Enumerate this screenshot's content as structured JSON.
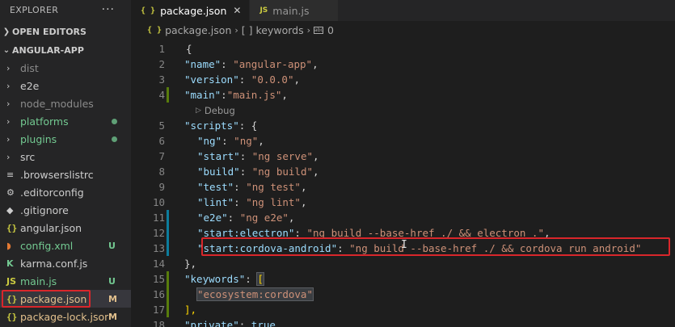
{
  "explorer": {
    "title": "EXPLORER",
    "more": "···",
    "open_editors": "OPEN EDITORS",
    "project": "ANGULAR-APP",
    "files": [
      {
        "label": "dist",
        "badge": ""
      },
      {
        "label": "e2e",
        "badge": ""
      },
      {
        "label": "node_modules",
        "badge": ""
      },
      {
        "label": "platforms",
        "badge": ""
      },
      {
        "label": "plugins",
        "badge": ""
      },
      {
        "label": "src",
        "badge": ""
      },
      {
        "label": ".browserslistrc",
        "badge": ""
      },
      {
        "label": ".editorconfig",
        "badge": ""
      },
      {
        "label": ".gitignore",
        "badge": ""
      },
      {
        "label": "angular.json",
        "badge": ""
      },
      {
        "label": "config.xml",
        "badge": "U"
      },
      {
        "label": "karma.conf.js",
        "badge": ""
      },
      {
        "label": "main.js",
        "badge": "U"
      },
      {
        "label": "package.json",
        "badge": "M"
      },
      {
        "label": "package-lock.json",
        "badge": "M"
      }
    ]
  },
  "tabs": [
    {
      "label": "package.json",
      "icon": "{ }",
      "close": "✕"
    },
    {
      "label": "main.js",
      "icon": "JS"
    }
  ],
  "breadcrumb": {
    "file": "package.json",
    "icon_file": "{ }",
    "icon_keywords": "[ ]",
    "keywords": "keywords",
    "index": "0",
    "sep": "›"
  },
  "codelens": "Debug",
  "code": {
    "l1": "{",
    "name_key": "\"name\"",
    "name_val": "\"angular-app\"",
    "version_key": "\"version\"",
    "version_val": "\"0.0.0\"",
    "main_key": "\"main\"",
    "main_val": "\"main.js\"",
    "scripts_key": "\"scripts\"",
    "ng_key": "\"ng\"",
    "ng_val": "\"ng\"",
    "start_key": "\"start\"",
    "start_val": "\"ng serve\"",
    "build_key": "\"build\"",
    "build_val": "\"ng build\"",
    "test_key": "\"test\"",
    "test_val": "\"ng test\"",
    "lint_key": "\"lint\"",
    "lint_val": "\"ng lint\"",
    "e2e_key": "\"e2e\"",
    "e2e_val": "\"ng e2e\"",
    "electron_key": "\"start:electron\"",
    "electron_val": "\"ng build --base-href ./ && electron .\"",
    "cordova_key": "\"start:cordova-android\"",
    "cordova_val": "\"ng build --base-href ./ && cordova run android\"",
    "close_obj": "},",
    "keywords_key": "\"keywords\"",
    "keyword_val": "\"ecosystem:cordova\"",
    "close_arr": "],",
    "private_key": "\"private\"",
    "private_val": "true"
  },
  "line_numbers": [
    "1",
    "2",
    "3",
    "4",
    "5",
    "6",
    "7",
    "8",
    "9",
    "10",
    "11",
    "12",
    "13",
    "14",
    "15",
    "16",
    "17",
    "18"
  ],
  "colors": {
    "accent_highlight": "#d9262b",
    "git_modified": "#0c7d9d",
    "git_added": "#587c0c"
  }
}
